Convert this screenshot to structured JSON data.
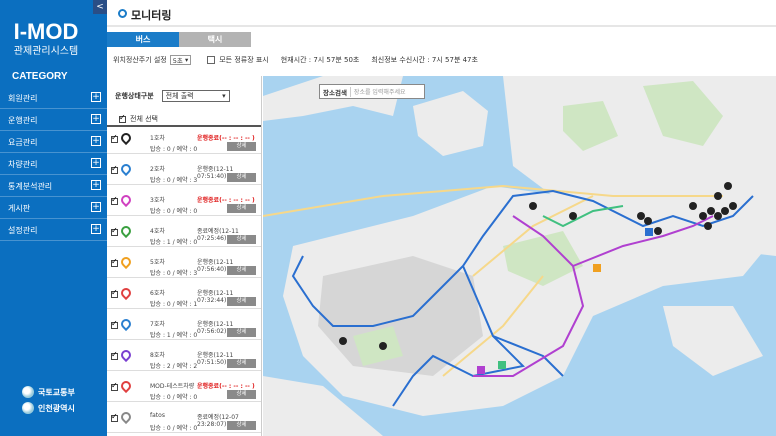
{
  "sidebar": {
    "collapse_glyph": "<",
    "logo_title": "I-MOD",
    "logo_subtitle": "관제관리시스템",
    "category_title": "CATEGORY",
    "items": [
      {
        "label": "회원관리"
      },
      {
        "label": "운행관리"
      },
      {
        "label": "요금관리"
      },
      {
        "label": "차량관리"
      },
      {
        "label": "통계분석관리"
      },
      {
        "label": "게시판"
      },
      {
        "label": "설정관리"
      }
    ],
    "gov_logos": [
      {
        "label": "국토교통부"
      },
      {
        "label": "인천광역시"
      }
    ]
  },
  "header": {
    "title": "모니터링"
  },
  "tabs": [
    {
      "label": "버스",
      "active": true
    },
    {
      "label": "택시",
      "active": false
    }
  ],
  "filters": {
    "period_label": "위치정산주기 설정",
    "period_value": "5초",
    "show_stops_label": "모든 정류장 표시",
    "current_time": "현재시간 : 7시 57분 50초",
    "last_received": "최신정보 수신시간 : 7시 57분 47초"
  },
  "list": {
    "status_filter_label": "운행상태구분",
    "status_filter_value": "전체 출력",
    "select_all_label": "전체 선택",
    "detail_label": "상세",
    "vehicles": [
      {
        "name": "1호차",
        "status": "운행종료(-- : -- : -- )",
        "status_red": true,
        "info": "탑승 : 0 / 예약 : 0",
        "pin_color": "#222"
      },
      {
        "name": "2호차",
        "status": "운행중(12-11 07:51:40)",
        "status_red": false,
        "info": "탑승 : 0 / 예약 : 3",
        "pin_color": "#2a7fd0"
      },
      {
        "name": "3호차",
        "status": "운행종료(-- : -- : -- )",
        "status_red": true,
        "info": "탑승 : 0 / 예약 : 0",
        "pin_color": "#d040c0"
      },
      {
        "name": "4호차",
        "status": "종료예정(12-11 07:25:46)",
        "status_red": false,
        "info": "탑승 : 1 / 예약 : 0",
        "pin_color": "#3aa040"
      },
      {
        "name": "5호차",
        "status": "운행중(12-11 07:56:40)",
        "status_red": false,
        "info": "탑승 : 0 / 예약 : 3",
        "pin_color": "#f0a020"
      },
      {
        "name": "6호차",
        "status": "운행중(12-11 07:32:44)",
        "status_red": false,
        "info": "탑승 : 0 / 예약 : 1",
        "pin_color": "#e04040"
      },
      {
        "name": "7호차",
        "status": "운행중(12-11 07:56:02)",
        "status_red": false,
        "info": "탑승 : 1 / 예약 : 0",
        "pin_color": "#2a7fd0"
      },
      {
        "name": "8호차",
        "status": "운행중(12-11 07:51:50)",
        "status_red": false,
        "info": "탑승 : 2 / 예약 : 2",
        "pin_color": "#7a3fd0"
      },
      {
        "name": "MOD-테스트차량",
        "status": "운행종료(-- : -- : -- )",
        "status_red": true,
        "info": "탑승 : 0 / 예약 : 0",
        "pin_color": "#e04040"
      },
      {
        "name": "fatos",
        "status": "종료예정(12-07 23:28:07)",
        "status_red": false,
        "info": "탑승 : 0 / 예약 : 0",
        "pin_color": "#888"
      }
    ]
  },
  "map": {
    "search_label": "장소검색",
    "search_placeholder": "장소를 입력해주세요",
    "colors": {
      "sea": "#a9d3f0",
      "land": "#ececec",
      "park": "#cfe6c3",
      "route_blue": "#2a6fd0",
      "route_purple": "#b040d0"
    }
  }
}
